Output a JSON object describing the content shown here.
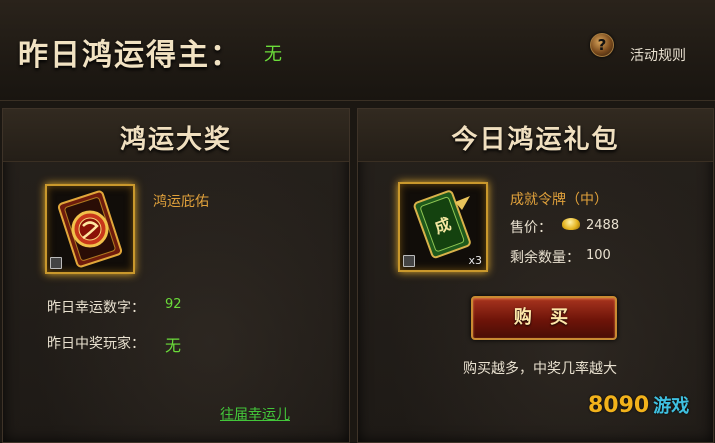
{
  "header": {
    "title": "昨日鸿运得主：",
    "winner": "无",
    "help_icon": "?",
    "rules_label": "活动规则"
  },
  "left_panel": {
    "title": "鸿运大奖",
    "item_name": "鸿运庇佑",
    "lucky_number_label": "昨日幸运数字：",
    "lucky_number_value": "92",
    "winner_label": "昨日中奖玩家：",
    "winner_value": "无",
    "past_link": "往届幸运儿"
  },
  "right_panel": {
    "title": "今日鸿运礼包",
    "item_name": "成就令牌（中）",
    "item_qty": "x3",
    "price_label": "售价：",
    "price_value": "2488",
    "remaining_label": "剩余数量：",
    "remaining_value": "100",
    "buy_label": "购 买",
    "tagline": "购买越多，中奖几率越大"
  },
  "watermark": {
    "logo": "8090",
    "suffix": "游戏"
  },
  "colors": {
    "accent_gold": "#e0a13b",
    "value_green": "#6bdc3a",
    "button_red": "#8a1c0c"
  }
}
